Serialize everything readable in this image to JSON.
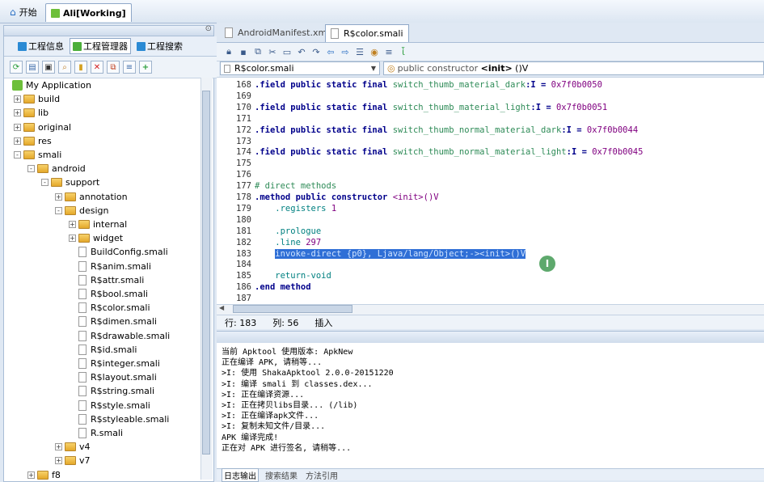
{
  "top_tabs": [
    {
      "label": "开始"
    },
    {
      "label": "Ali[Working]"
    }
  ],
  "left_tabs": [
    {
      "label": "工程信息",
      "color": "#2a8ad4"
    },
    {
      "label": "工程管理器",
      "color": "#4caf3a"
    },
    {
      "label": "工程搜索",
      "color": "#2a8ad4"
    }
  ],
  "left_tool_icons": [
    "refresh-icon",
    "view-icon",
    "window-icon",
    "search-icon",
    "book-icon",
    "delete-icon",
    "copy-icon",
    "list-icon",
    "add-icon"
  ],
  "tree": [
    {
      "label": "My Application",
      "kind": "app",
      "depth": 0
    },
    {
      "label": "build",
      "kind": "folder",
      "depth": 1,
      "exp": "+"
    },
    {
      "label": "lib",
      "kind": "folder",
      "depth": 1,
      "exp": "+"
    },
    {
      "label": "original",
      "kind": "folder",
      "depth": 1,
      "exp": "+"
    },
    {
      "label": "res",
      "kind": "folder",
      "depth": 1,
      "exp": "+"
    },
    {
      "label": "smali",
      "kind": "folder",
      "depth": 1,
      "exp": "-"
    },
    {
      "label": "android",
      "kind": "folder",
      "depth": 2,
      "exp": "-"
    },
    {
      "label": "support",
      "kind": "folder",
      "depth": 3,
      "exp": "-"
    },
    {
      "label": "annotation",
      "kind": "folder",
      "depth": 4,
      "exp": "+"
    },
    {
      "label": "design",
      "kind": "folder",
      "depth": 4,
      "exp": "-"
    },
    {
      "label": "internal",
      "kind": "folder",
      "depth": 5,
      "exp": "+"
    },
    {
      "label": "widget",
      "kind": "folder",
      "depth": 5,
      "exp": "+"
    },
    {
      "label": "BuildConfig.smali",
      "kind": "file",
      "depth": 5
    },
    {
      "label": "R$anim.smali",
      "kind": "file",
      "depth": 5
    },
    {
      "label": "R$attr.smali",
      "kind": "file",
      "depth": 5
    },
    {
      "label": "R$bool.smali",
      "kind": "file",
      "depth": 5
    },
    {
      "label": "R$color.smali",
      "kind": "file",
      "depth": 5
    },
    {
      "label": "R$dimen.smali",
      "kind": "file",
      "depth": 5
    },
    {
      "label": "R$drawable.smali",
      "kind": "file",
      "depth": 5
    },
    {
      "label": "R$id.smali",
      "kind": "file",
      "depth": 5
    },
    {
      "label": "R$integer.smali",
      "kind": "file",
      "depth": 5
    },
    {
      "label": "R$layout.smali",
      "kind": "file",
      "depth": 5
    },
    {
      "label": "R$string.smali",
      "kind": "file",
      "depth": 5
    },
    {
      "label": "R$style.smali",
      "kind": "file",
      "depth": 5
    },
    {
      "label": "R$styleable.smali",
      "kind": "file",
      "depth": 5
    },
    {
      "label": "R.smali",
      "kind": "file",
      "depth": 5
    },
    {
      "label": "v4",
      "kind": "folder",
      "depth": 4,
      "exp": "+"
    },
    {
      "label": "v7",
      "kind": "folder",
      "depth": 4,
      "exp": "+"
    },
    {
      "label": "f8",
      "kind": "folder",
      "depth": 2,
      "exp": "+"
    }
  ],
  "editor_tabs": [
    {
      "label": "AndroidManifest.xml"
    },
    {
      "label": "R$color.smali"
    }
  ],
  "editor_tool_icons": [
    "lock-icon",
    "save-icon",
    "copy-icon",
    "cut-icon",
    "paste-icon",
    "undo-icon",
    "redo-icon",
    "back-icon",
    "forward-icon",
    "format-icon",
    "bookmark-icon",
    "list-icon",
    "mark-icon"
  ],
  "class_combo": "R$color.smali",
  "method_combo": {
    "prefix": "public constructor ",
    "name": "<init>",
    "suffix": " ()V"
  },
  "code_lines": [
    {
      "n": "168",
      "segs": [
        [
          ".field public static final ",
          "kw"
        ],
        [
          "switch_thumb_material_dark",
          "gr"
        ],
        [
          ":I = ",
          "kw"
        ],
        [
          "0x7f0b0050",
          "hex"
        ]
      ]
    },
    {
      "n": "169",
      "segs": []
    },
    {
      "n": "170",
      "segs": [
        [
          ".field public static final ",
          "kw"
        ],
        [
          "switch_thumb_material_light",
          "gr"
        ],
        [
          ":I = ",
          "kw"
        ],
        [
          "0x7f0b0051",
          "hex"
        ]
      ]
    },
    {
      "n": "171",
      "segs": []
    },
    {
      "n": "172",
      "segs": [
        [
          ".field public static final ",
          "kw"
        ],
        [
          "switch_thumb_normal_material_dark",
          "gr"
        ],
        [
          ":I = ",
          "kw"
        ],
        [
          "0x7f0b0044",
          "hex"
        ]
      ]
    },
    {
      "n": "173",
      "segs": []
    },
    {
      "n": "174",
      "segs": [
        [
          ".field public static final ",
          "kw"
        ],
        [
          "switch_thumb_normal_material_light",
          "gr"
        ],
        [
          ":I = ",
          "kw"
        ],
        [
          "0x7f0b0045",
          "hex"
        ]
      ]
    },
    {
      "n": "175",
      "segs": []
    },
    {
      "n": "176",
      "segs": []
    },
    {
      "n": "177",
      "segs": [
        [
          "# direct methods",
          "cm"
        ]
      ]
    },
    {
      "n": "178",
      "segs": [
        [
          ".method public constructor ",
          "kw"
        ],
        [
          "<init>()V",
          "hex"
        ]
      ]
    },
    {
      "n": "179",
      "segs": [
        [
          "    .registers ",
          "dir"
        ],
        [
          "1",
          "hex"
        ]
      ]
    },
    {
      "n": "180",
      "segs": []
    },
    {
      "n": "181",
      "segs": [
        [
          "    .prologue",
          "dir"
        ]
      ]
    },
    {
      "n": "182",
      "segs": [
        [
          "    .line ",
          "dir"
        ],
        [
          "297",
          "hex"
        ]
      ]
    },
    {
      "n": "183",
      "segs": [
        [
          "    ",
          ""
        ],
        [
          "invoke-direct {p0}, Ljava/lang/Object;-><init>()V",
          "sel"
        ]
      ]
    },
    {
      "n": "184",
      "segs": []
    },
    {
      "n": "185",
      "segs": [
        [
          "    return-void",
          "dir"
        ]
      ]
    },
    {
      "n": "186",
      "segs": [
        [
          ".end method",
          "kw"
        ]
      ]
    },
    {
      "n": "187",
      "segs": []
    }
  ],
  "status": {
    "row": "行: 183",
    "col": "列: 56",
    "mode": "插入"
  },
  "output_lines": [
    "当前 Apktool 使用版本: ApkNew",
    "正在编译 APK, 请稍等...",
    ">I: 使用 ShakaApktool 2.0.0-20151220",
    ">I: 编译 smali 到 classes.dex...",
    ">I: 正在编译资源...",
    ">I: 正在拷贝libs目录... (/lib)",
    ">I: 正在编译apk文件...",
    ">I: 复制未知文件/目录...",
    "APK 编译完成!",
    "正在对 APK 进行签名, 请稍等..."
  ],
  "output_tabs": [
    {
      "label": "日志输出"
    },
    {
      "label": "搜索结果"
    },
    {
      "label": "方法引用"
    }
  ]
}
